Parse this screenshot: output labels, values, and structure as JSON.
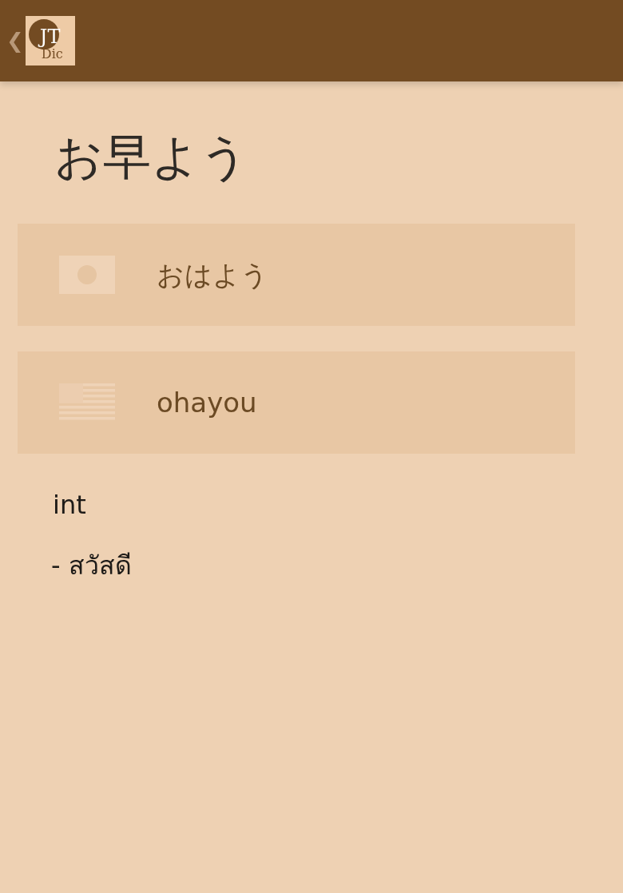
{
  "app_bar": {
    "back": "❮",
    "logo": {
      "main": "JT",
      "sub": "Dic"
    }
  },
  "word": "お早よう",
  "readings": [
    {
      "kind": "japanese",
      "text": "おはよう"
    },
    {
      "kind": "romaji",
      "text": "ohayou"
    }
  ],
  "part_of_speech": "int",
  "meanings": [
    "- สวัสดี"
  ]
}
